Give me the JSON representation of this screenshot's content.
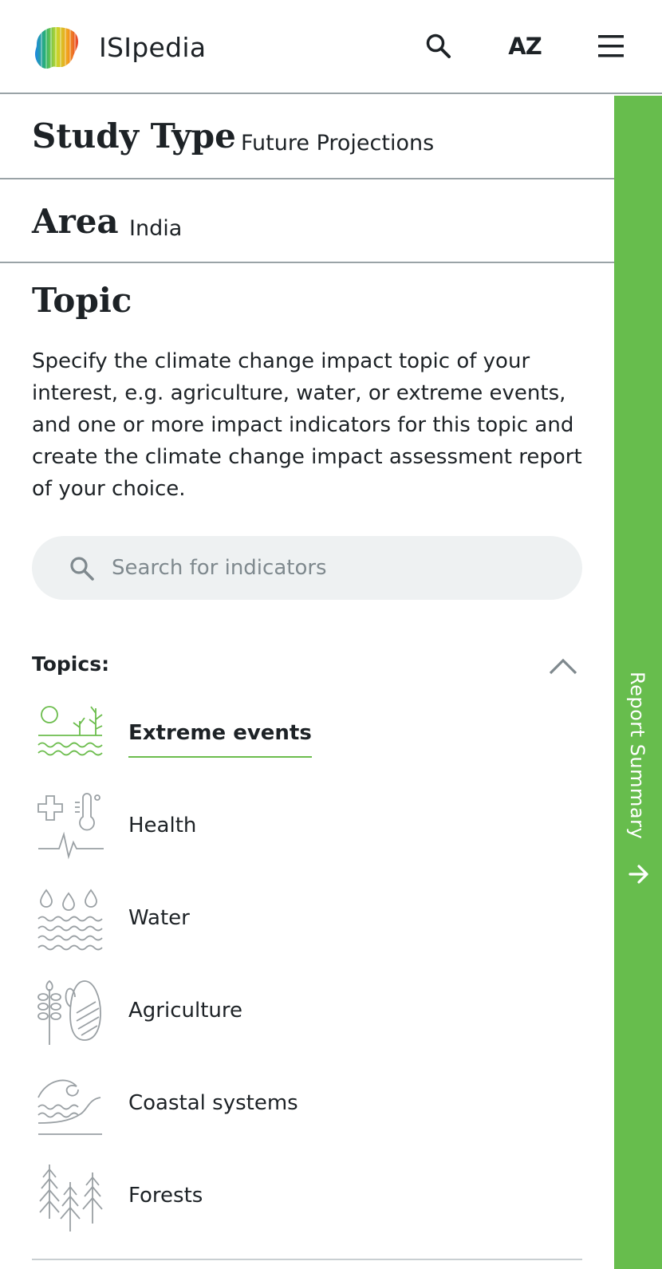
{
  "header": {
    "brand": "ISIpedia",
    "az_label": "AZ",
    "icons": {
      "search": "search-icon",
      "menu": "hamburger-menu-icon"
    }
  },
  "study_type": {
    "label": "Study Type",
    "value": "Future Projections"
  },
  "area": {
    "label": "Area",
    "value": "India"
  },
  "topic": {
    "title": "Topic",
    "description": "Specify the climate change impact topic of your interest, e.g. agriculture, water, or extreme events, and one or more impact indicators for this topic and create the climate change impact assessment report of your choice."
  },
  "search": {
    "placeholder": "Search for indicators",
    "value": ""
  },
  "topics": {
    "label": "Topics:",
    "items": [
      {
        "label": "Extreme events",
        "icon": "extreme-events-icon",
        "active": true
      },
      {
        "label": "Health",
        "icon": "health-icon",
        "active": false
      },
      {
        "label": "Water",
        "icon": "water-icon",
        "active": false
      },
      {
        "label": "Agriculture",
        "icon": "agriculture-icon",
        "active": false
      },
      {
        "label": "Coastal systems",
        "icon": "coastal-systems-icon",
        "active": false
      },
      {
        "label": "Forests",
        "icon": "forests-icon",
        "active": false
      }
    ]
  },
  "side_tab": {
    "label": "Report Summary"
  },
  "colors": {
    "accent": "#67bd4d",
    "divider": "#9aa3a7",
    "text": "#1d2226",
    "search_bg": "#eef1f2"
  }
}
